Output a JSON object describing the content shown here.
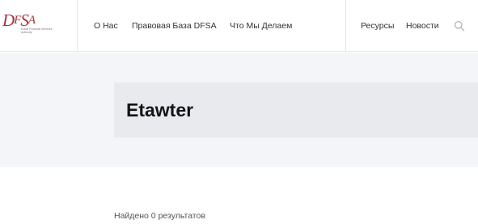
{
  "header": {
    "logo": {
      "mark": "DFSA",
      "subtitle": "Dubai Financial Services Authority"
    },
    "nav": {
      "about": "О Нас",
      "legal_base": "Правовая База DFSA",
      "what_we_do": "Что Мы Делаем",
      "resources": "Ресурсы",
      "news": "Новости"
    },
    "search_icon": "search-icon"
  },
  "hero": {
    "title": "Etawter"
  },
  "results": {
    "summary": "Найдено 0 результатов"
  },
  "colors": {
    "brand": "#a8323c",
    "hero_bg": "#f4f5f8",
    "title_box_bg": "#e9eaed"
  }
}
